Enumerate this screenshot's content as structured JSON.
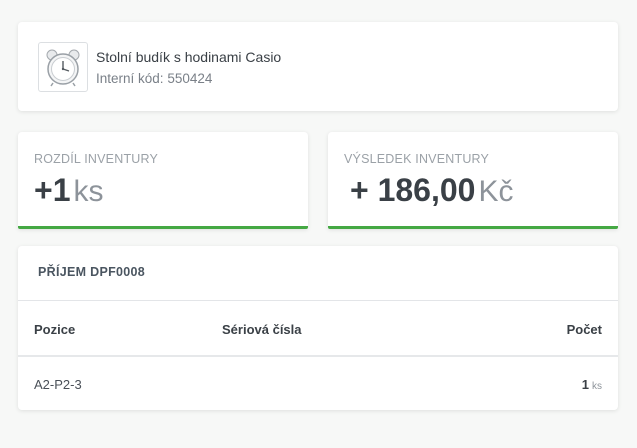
{
  "product": {
    "name": "Stolní budík s hodinami Casio",
    "code_label": "Interní kód:",
    "code_value": "550424",
    "thumbnail_icon": "alarm-clock-icon"
  },
  "stats": {
    "difference": {
      "label": "ROZDÍL INVENTURY",
      "value": "+1",
      "unit": "ks"
    },
    "result": {
      "label": "VÝSLEDEK INVENTURY",
      "value": "+ 186,00",
      "unit": "Kč"
    },
    "accent_color": "#44a843"
  },
  "receipt": {
    "title": "PŘÍJEM DPF0008",
    "columns": {
      "position": "Pozice",
      "serials": "Sériová čísla",
      "quantity": "Počet"
    },
    "rows": [
      {
        "position": "A2-P2-3",
        "serials": "",
        "quantity": "1",
        "unit": "ks"
      }
    ]
  }
}
